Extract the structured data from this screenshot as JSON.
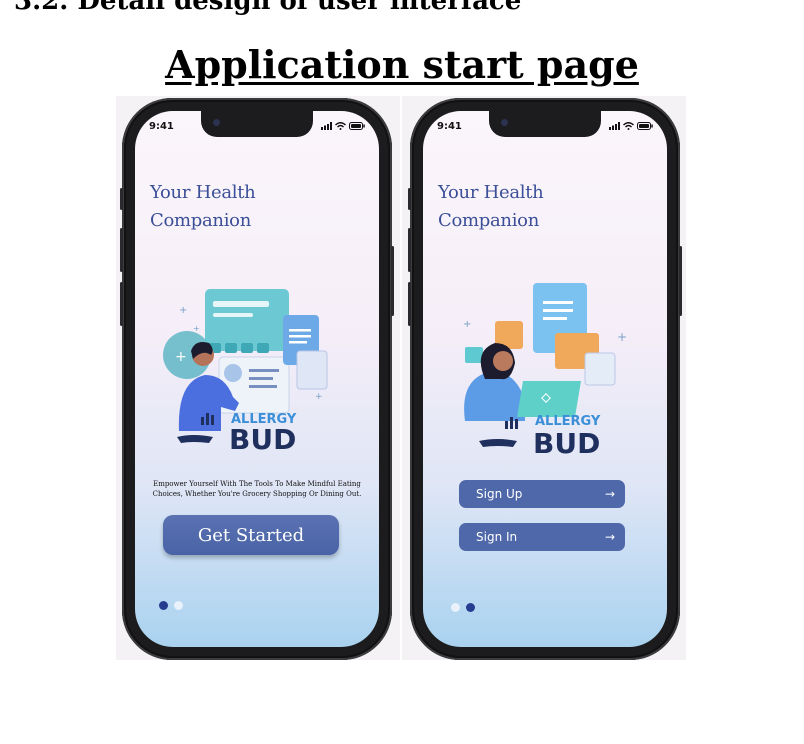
{
  "section_heading": "3.2. Detail design of user interface",
  "page_title": "Application start page",
  "phones": [
    {
      "status": {
        "time": "9:41",
        "icons": [
          "signal-icon",
          "wifi-icon",
          "battery-icon"
        ]
      },
      "headline": {
        "line1": "Your Health",
        "line2": "Companion"
      },
      "logo": {
        "top": "ALLERGY",
        "bottom": "BUD"
      },
      "tagline": {
        "line1": "Empower Yourself With The Tools To Make Mindful Eating",
        "line2": "Choices, Whether You're Grocery Shopping Or Dining Out."
      },
      "cta_label": "Get Started",
      "pager": {
        "count": 2,
        "active_index": 0
      }
    },
    {
      "status": {
        "time": "9:41",
        "icons": [
          "signal-icon",
          "wifi-icon",
          "battery-icon"
        ]
      },
      "headline": {
        "line1": "Your Health",
        "line2": "Companion"
      },
      "logo": {
        "top": "ALLERGY",
        "bottom": "BUD"
      },
      "buttons": [
        {
          "label": "Sign Up",
          "icon": "arrow-right-icon"
        },
        {
          "label": "Sign In",
          "icon": "arrow-right-icon"
        }
      ],
      "pager": {
        "count": 2,
        "active_index": 1
      }
    }
  ],
  "colors": {
    "headline": "#3b4f98",
    "button": "#4f68aa",
    "dot_active": "#243d8f",
    "dot_inactive": "#e9f2fb",
    "logo": "#1f2f5e",
    "illustration_teal": "#5fc9d2"
  }
}
